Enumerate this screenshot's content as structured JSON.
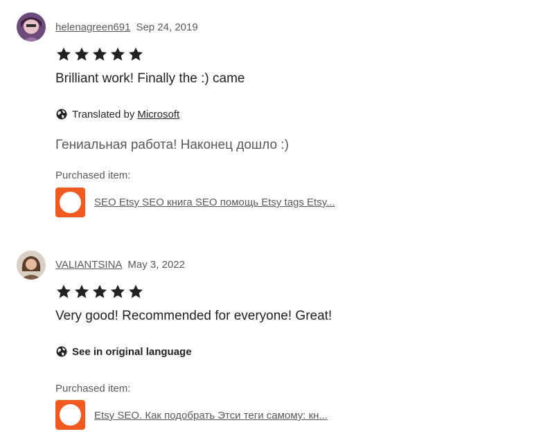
{
  "reviews": [
    {
      "username": "helenagreen691",
      "date": "Sep 24, 2019",
      "rating": 5,
      "text": "Brilliant work! Finally the :) came",
      "translated_prefix": "Translated by",
      "translated_link": "Microsoft",
      "original_text": "Гениальная работа! Наконец дошло :)",
      "purchased_label": "Purchased item:",
      "item_title": "SEO Etsy SEO книга SEO помощь Etsy tags Etsy..."
    },
    {
      "username": "VALIANTSINA",
      "date": "May 3, 2022",
      "rating": 5,
      "text": "Very good! Recommended for everyone! Great!",
      "see_original": "See in original language",
      "purchased_label": "Purchased item:",
      "item_title": "Etsy SEO. Как подобрать Этси теги самому: кн..."
    }
  ],
  "colors": {
    "accent": "#f05a1f",
    "text": "#222222",
    "muted": "#595959"
  }
}
